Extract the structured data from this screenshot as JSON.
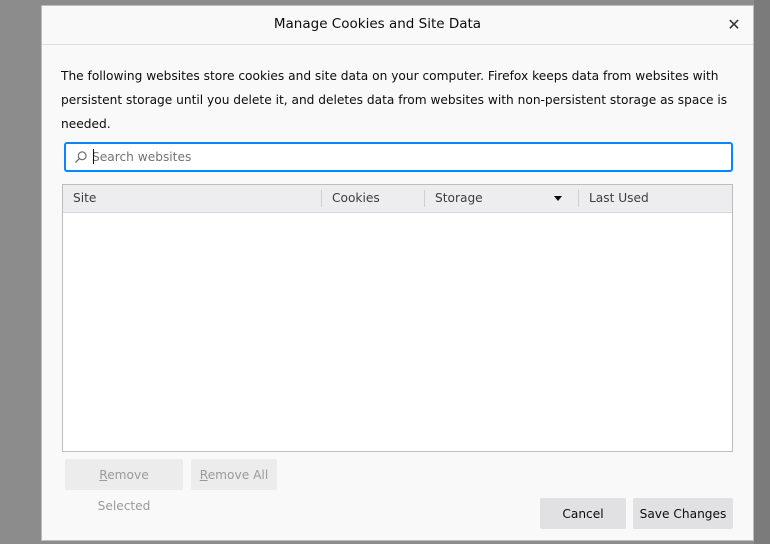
{
  "dialog": {
    "title": "Manage Cookies and Site Data",
    "close_glyph": "✕",
    "description": "The following websites store cookies and site data on your computer. Firefox keeps data from websites with persistent storage until you delete it, and deletes data from websites with non-persistent storage as space is needed."
  },
  "search": {
    "placeholder": "Search websites",
    "value": ""
  },
  "table": {
    "columns": {
      "site": "Site",
      "cookies": "Cookies",
      "storage": "Storage",
      "last_used": "Last Used"
    },
    "sort_column": "Storage",
    "sort_direction": "descending",
    "rows": []
  },
  "buttons": {
    "remove_selected_first": "R",
    "remove_selected_rest": "emove Selected",
    "remove_all_first": "R",
    "remove_all_rest": "emove All",
    "cancel": "Cancel",
    "save_changes": "Save Changes"
  },
  "colors": {
    "accent": "#0a84ff",
    "dialog_bg": "#f9f9fa",
    "header_bg": "#ededf0",
    "backdrop": "#8c8c8c"
  },
  "icons": {
    "search": "search-icon",
    "close": "close-icon",
    "sort": "sort-descending-icon"
  }
}
